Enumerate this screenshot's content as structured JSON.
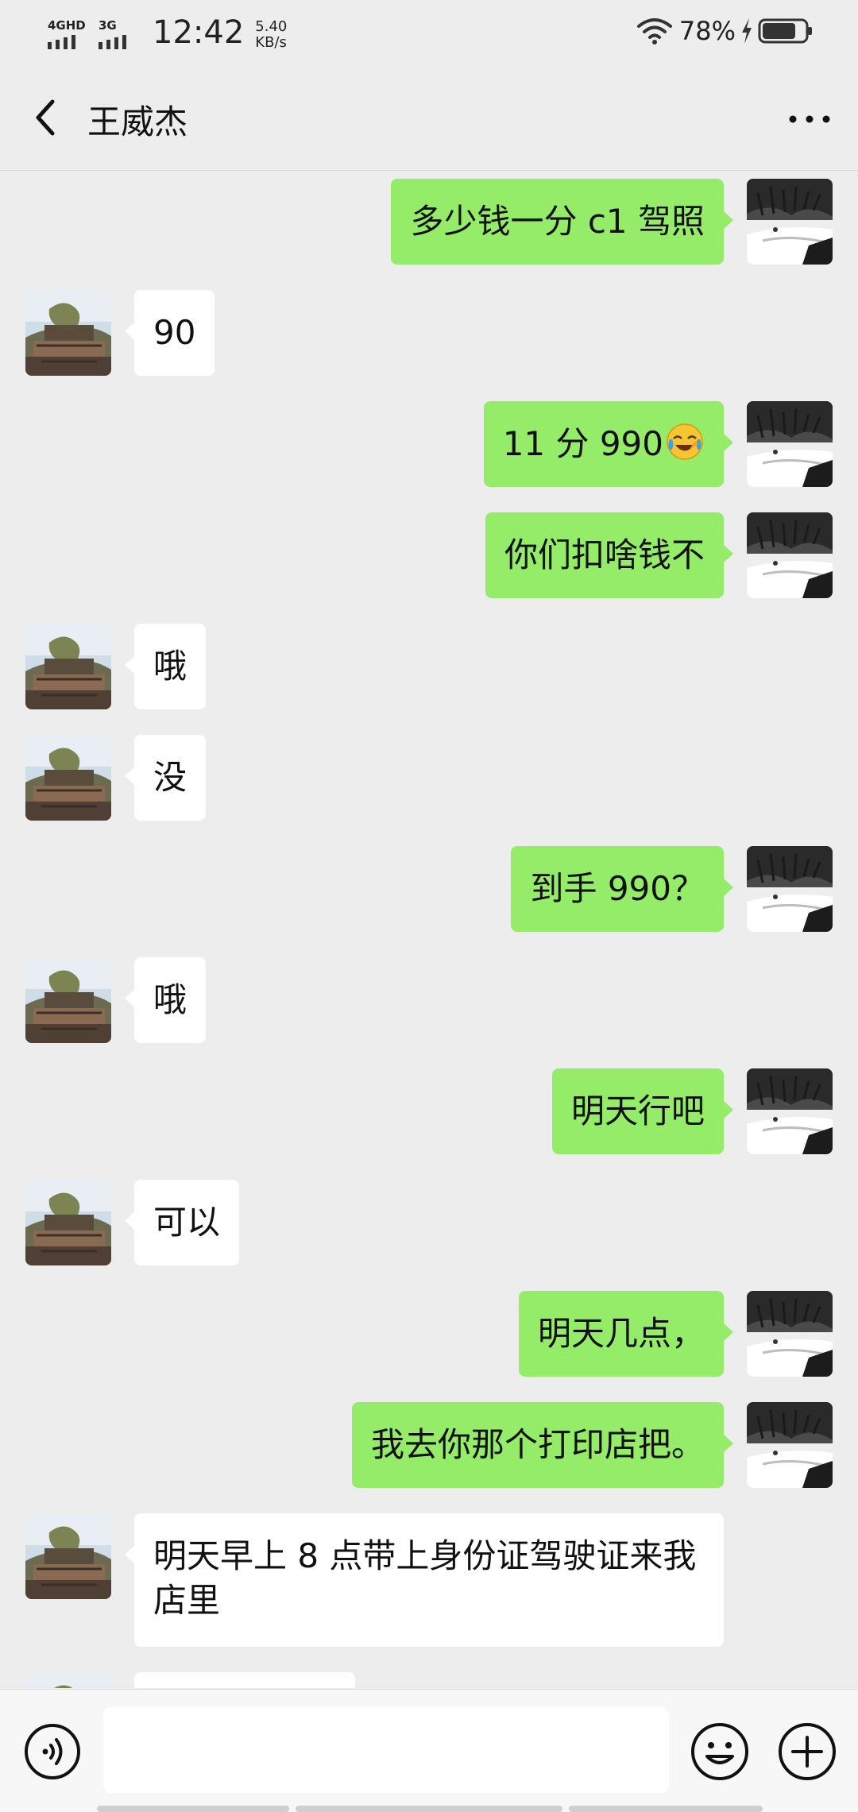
{
  "status_bar": {
    "network1": "4GHD",
    "network2": "3G",
    "time": "12:42",
    "speed_value": "5.40",
    "speed_unit": "KB/s",
    "battery_percent": "78%",
    "battery_level": 0.78
  },
  "header": {
    "title": "王威杰",
    "back_icon": "chevron-left-icon",
    "more_icon": "more-dots-icon"
  },
  "messages": [
    {
      "side": "out",
      "text": "多少钱一分 c1 驾照"
    },
    {
      "side": "in",
      "text": "90"
    },
    {
      "side": "out",
      "text": "11 分 990",
      "emoji": "face-with-tears-of-joy"
    },
    {
      "side": "out",
      "text": "你们扣啥钱不"
    },
    {
      "side": "in",
      "text": "哦"
    },
    {
      "side": "in",
      "text": "没"
    },
    {
      "side": "out",
      "text": "到手 990？"
    },
    {
      "side": "in",
      "text": "哦"
    },
    {
      "side": "out",
      "text": "明天行吧"
    },
    {
      "side": "in",
      "text": "可以"
    },
    {
      "side": "out",
      "text": "明天几点，"
    },
    {
      "side": "out",
      "text": "我去你那个打印店把。"
    },
    {
      "side": "in",
      "text": "明天早上 8 点带上身份证驾驶证来我店里"
    }
  ],
  "input_bar": {
    "voice_icon": "voice-icon",
    "emoji_icon": "emoji-icon",
    "plus_icon": "plus-icon"
  },
  "colors": {
    "outgoing_bubble": "#95ec69",
    "incoming_bubble": "#ffffff",
    "background": "#ededed"
  }
}
